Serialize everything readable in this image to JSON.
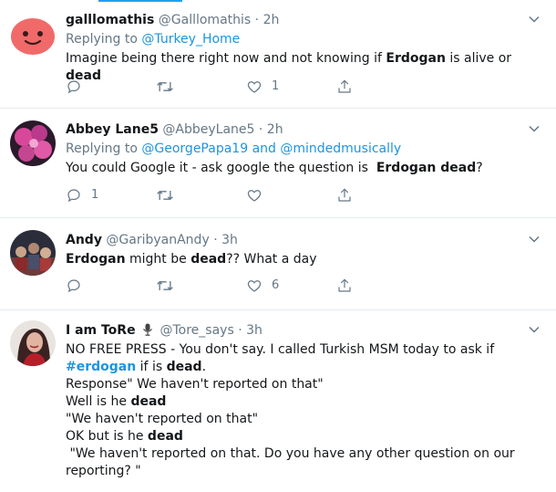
{
  "tweets": [
    {
      "name": "galllomathis",
      "handle": "@Galllomathis",
      "dot": "·",
      "time": "2h",
      "reply_prefix": "Replying to",
      "reply_to": "@Turkey_Home",
      "reply_mid": "",
      "reply_to2": "",
      "text_parts": [
        "Imagine being there right now and not knowing if ",
        "Erdogan",
        " is alive or ",
        "dead"
      ],
      "actions": {
        "reply_count": "",
        "retweet_count": "",
        "like_count": "1"
      }
    },
    {
      "name": "Abbey Lane5",
      "handle": "@AbbeyLane5",
      "dot": "·",
      "time": "2h",
      "reply_prefix": "Replying to",
      "reply_to": "@GeorgePapa19",
      "reply_mid": "and",
      "reply_to2": "@mindedmusically",
      "text_parts": [
        "You could Google it - ask google the question is  ",
        "Erdogan dead",
        "?"
      ],
      "actions": {
        "reply_count": "1",
        "retweet_count": "",
        "like_count": ""
      }
    },
    {
      "name": "Andy",
      "handle": "@GaribyanAndy",
      "dot": "·",
      "time": "3h",
      "text_parts": [
        "Erdogan",
        " might be ",
        "dead",
        "?? What a day"
      ],
      "actions": {
        "reply_count": "",
        "retweet_count": "",
        "like_count": "6"
      }
    },
    {
      "name": "I am ToRe",
      "handle": "@Tore_says",
      "dot": "·",
      "time": "3h",
      "lines": [
        "NO FREE PRESS - You don't say. I called Turkish MSM today to ask if",
        "#erdogan",
        " if is ",
        "dead",
        ".",
        "Response\" We haven't reported on that\"",
        "Well is he ",
        "dead",
        "\"We haven't reported on that\"",
        "OK but is he ",
        "dead",
        " \"We haven't reported on that. Do you have any other question on our",
        "reporting? \""
      ]
    }
  ],
  "icons": [
    "chevron-down-icon",
    "reply-icon",
    "retweet-icon",
    "like-icon",
    "share-icon",
    "microphone-icon"
  ],
  "colors": {
    "link": "#1b95e0",
    "muted": "#657786",
    "text": "#14171a",
    "divider": "#e6ecf0"
  }
}
